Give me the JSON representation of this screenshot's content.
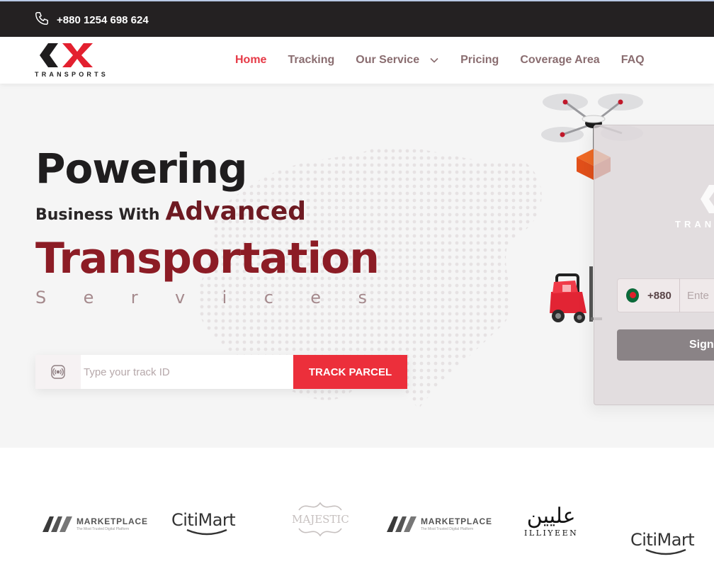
{
  "topbar": {
    "phone_number": "+880 1254 698 624"
  },
  "brand": {
    "logo_wordmark": "TRANSPORTS",
    "accent": "#e63946"
  },
  "nav": {
    "items": [
      {
        "label": "Home",
        "active": true
      },
      {
        "label": "Tracking",
        "active": false
      },
      {
        "label": "Our Service",
        "active": false,
        "has_dropdown": true
      },
      {
        "label": "Pricing",
        "active": false
      },
      {
        "label": "Coverage Area",
        "active": false
      },
      {
        "label": "FAQ",
        "active": false
      }
    ]
  },
  "hero": {
    "line1": "Powering",
    "line2_small": "Business With",
    "line2_accent": "Advanced",
    "line3": "Transportation",
    "line4_letters": [
      "S",
      "e",
      "r",
      "v",
      "i",
      "c",
      "e",
      "s"
    ],
    "track": {
      "placeholder": "Type your track ID",
      "button_label": "TRACK PARCEL"
    }
  },
  "signin_card": {
    "logo_wordmark": "TRAN",
    "country_code": "+880",
    "phone_placeholder": "Ente",
    "button_label": "Sign"
  },
  "brands": [
    {
      "type": "marketplace",
      "name": "MARKETPLACE",
      "tagline": "The Most Trusted Digital Platform"
    },
    {
      "type": "citimart",
      "name": "CitiMart"
    },
    {
      "type": "majestic",
      "name": "MAJESTIC"
    },
    {
      "type": "marketplace",
      "name": "MARKETPLACE",
      "tagline": "The Most Trusted Digital Platform"
    },
    {
      "type": "illiyeen",
      "name": "ILLIYEEN",
      "arabic": "عليين"
    },
    {
      "type": "citimart",
      "name": "CitiMart"
    }
  ]
}
